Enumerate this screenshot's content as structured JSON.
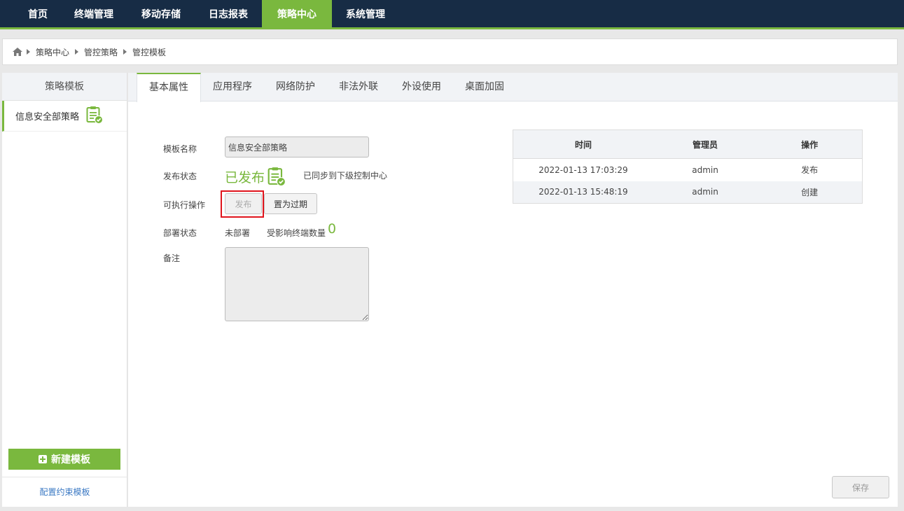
{
  "nav": {
    "items": [
      {
        "label": "首页",
        "active": false
      },
      {
        "label": "终端管理",
        "active": false
      },
      {
        "label": "移动存储",
        "active": false
      },
      {
        "label": "日志报表",
        "active": false
      },
      {
        "label": "策略中心",
        "active": true
      },
      {
        "label": "系统管理",
        "active": false
      }
    ],
    "active_color": "#7ab83e",
    "bg_color": "#172c45"
  },
  "breadcrumb": {
    "items": [
      "策略中心",
      "管控策略",
      "管控模板"
    ]
  },
  "sidebar": {
    "title": "策略模板",
    "items": [
      {
        "label": "信息安全部策略",
        "icon": "clipboard-check-icon"
      }
    ],
    "new_button": "新建模板",
    "footer_link": "配置约束模板"
  },
  "tabs": [
    {
      "label": "基本属性",
      "active": true
    },
    {
      "label": "应用程序",
      "active": false
    },
    {
      "label": "网络防护",
      "active": false
    },
    {
      "label": "非法外联",
      "active": false
    },
    {
      "label": "外设使用",
      "active": false
    },
    {
      "label": "桌面加固",
      "active": false
    }
  ],
  "form": {
    "name_label": "模板名称",
    "name_value": "信息安全部策略",
    "status_label": "发布状态",
    "status_value": "已发布",
    "sync_note": "已同步到下级控制中心",
    "actions_label": "可执行操作",
    "publish_button": "发布",
    "expire_button": "置为过期",
    "deploy_label": "部署状态",
    "deploy_value": "未部署",
    "affected_label": "受影响终端数量",
    "affected_count": "0",
    "remark_label": "备注",
    "remark_value": ""
  },
  "history": {
    "headers": [
      "时间",
      "管理员",
      "操作"
    ],
    "rows": [
      [
        "2022-01-13 17:03:29",
        "admin",
        "发布"
      ],
      [
        "2022-01-13 15:48:19",
        "admin",
        "创建"
      ]
    ]
  },
  "save_button": "保存",
  "colors": {
    "accent": "#7ab83e",
    "highlight": "#e0141c",
    "link": "#3a78c3"
  }
}
